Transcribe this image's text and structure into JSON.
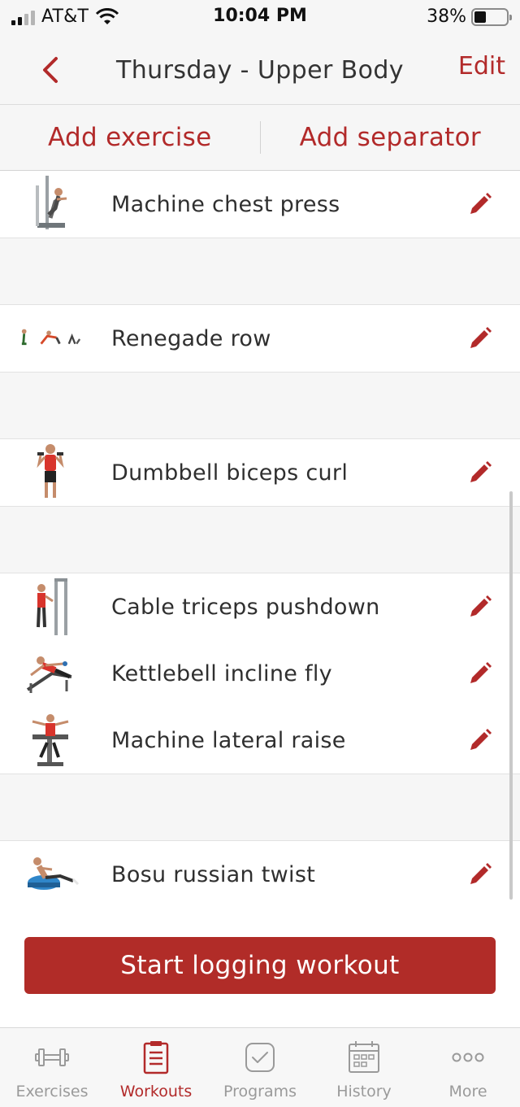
{
  "status_bar": {
    "carrier": "AT&T",
    "time": "10:04 PM",
    "battery": "38%"
  },
  "nav": {
    "title": "Thursday - Upper Body",
    "edit_label": "Edit"
  },
  "actions": {
    "add_exercise": "Add exercise",
    "add_separator": "Add separator"
  },
  "exercises": [
    "Machine chest press",
    "Renegade row",
    "Dumbbell biceps curl",
    "Cable triceps pushdown",
    "Kettlebell incline fly",
    "Machine lateral raise",
    "Bosu russian twist"
  ],
  "start_button": "Start logging workout",
  "tabs": [
    "Exercises",
    "Workouts",
    "Programs",
    "History",
    "More"
  ],
  "colors": {
    "accent": "#b22a2a",
    "button": "#b12c28"
  }
}
